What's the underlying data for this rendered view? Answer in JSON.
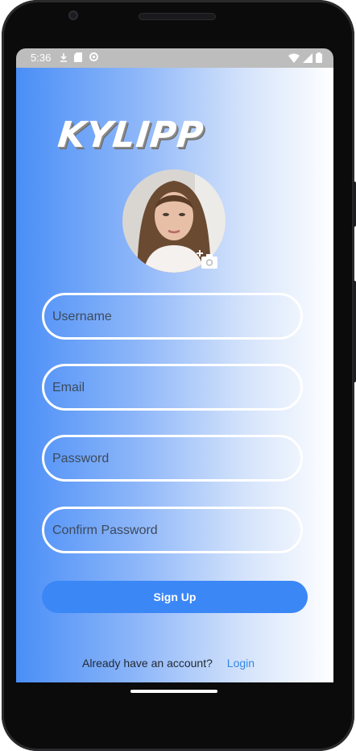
{
  "status_bar": {
    "time": "5:36",
    "icons_left": [
      "download-icon",
      "sd-card-icon",
      "settings-icon"
    ],
    "icons_right": [
      "wifi-icon",
      "signal-icon",
      "battery-icon"
    ]
  },
  "app": {
    "logo_text": "KYLIPP",
    "profile": {
      "avatar": "profile-photo",
      "badge_icon": "add-photo-icon"
    },
    "fields": [
      {
        "id": "username",
        "placeholder": "Username"
      },
      {
        "id": "email",
        "placeholder": "Email"
      },
      {
        "id": "password",
        "placeholder": "Password"
      },
      {
        "id": "confirm",
        "placeholder": "Confirm Password"
      }
    ],
    "signup_button": "Sign Up",
    "footer": {
      "prompt": "Already have an account?",
      "login_link": "Login"
    }
  },
  "colors": {
    "gradient_start": "#4a8ef7",
    "gradient_end": "#ffffff",
    "button": "#3b87f6",
    "link": "#3287e8"
  }
}
